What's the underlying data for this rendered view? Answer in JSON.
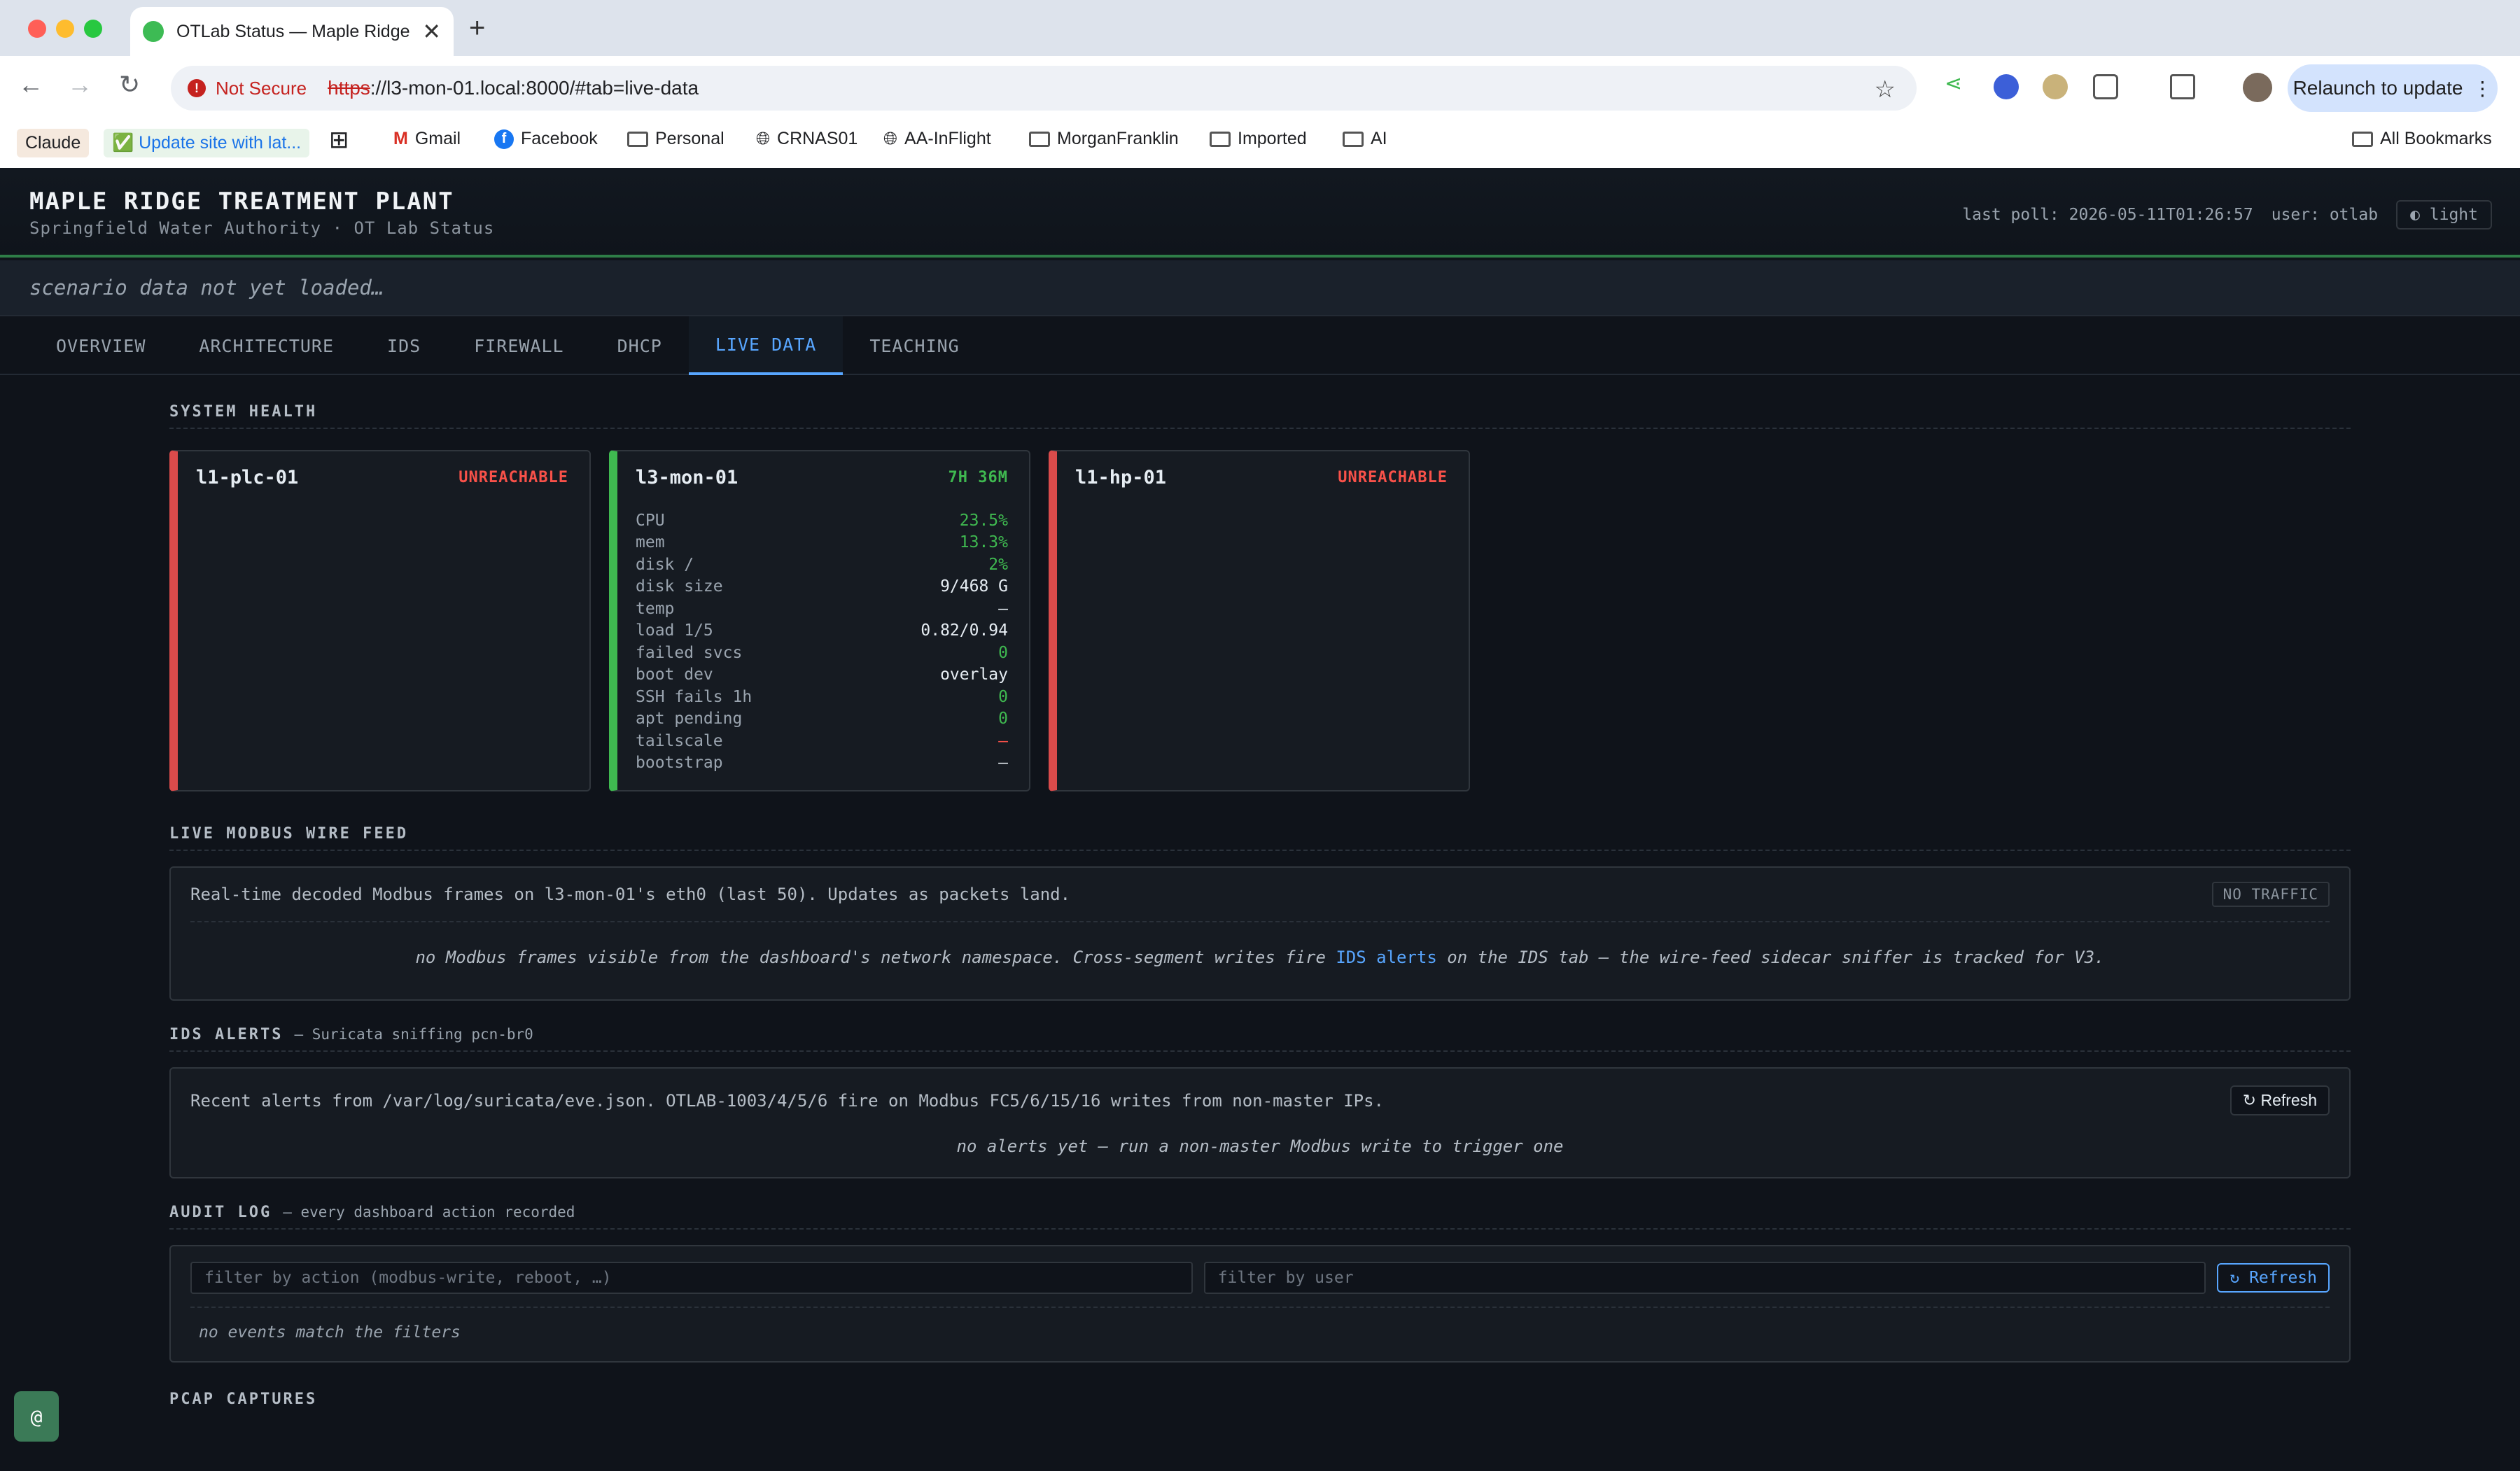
{
  "browser": {
    "tab_title": "OTLab Status — Maple Ridge",
    "security_label": "Not Secure",
    "url_scheme": "https",
    "url_rest": "://l3-mon-01.local:8000/#tab=live-data",
    "relaunch_label": "Relaunch to update",
    "bookmarks": [
      "Claude",
      "✅ Update site with lat...",
      "Gmail",
      "Facebook",
      "Personal",
      "CRNAS01",
      "AA-InFlight",
      "MorganFranklin",
      "Imported",
      "AI"
    ],
    "all_bookmarks": "All Bookmarks"
  },
  "header": {
    "plant": "MAPLE RIDGE TREATMENT PLANT",
    "subtitle": "Springfield Water Authority · OT Lab Status",
    "last_poll": "last poll: 2026-05-11T01:26:57",
    "user": "user: otlab",
    "theme_toggle": "◐ light"
  },
  "scenario": "scenario data not yet loaded…",
  "tabs": [
    "OVERVIEW",
    "ARCHITECTURE",
    "IDS",
    "FIREWALL",
    "DHCP",
    "LIVE DATA",
    "TEACHING"
  ],
  "active_tab": "LIVE DATA",
  "system_health": {
    "title": "SYSTEM HEALTH",
    "cards": [
      {
        "name": "l1-plc-01",
        "status": "UNREACHABLE"
      },
      {
        "name": "l3-mon-01",
        "status": "7H 36M",
        "metrics": [
          {
            "label": "CPU",
            "value": "23.5%",
            "tone": "good"
          },
          {
            "label": "mem",
            "value": "13.3%",
            "tone": "good"
          },
          {
            "label": "disk /",
            "value": "2%",
            "tone": "good"
          },
          {
            "label": "disk size",
            "value": "9/468 G",
            "tone": "plain"
          },
          {
            "label": "temp",
            "value": "—",
            "tone": "plain"
          },
          {
            "label": "load 1/5",
            "value": "0.82/0.94",
            "tone": "plain"
          },
          {
            "label": "failed svcs",
            "value": "0",
            "tone": "good"
          },
          {
            "label": "boot dev",
            "value": "overlay",
            "tone": "plain"
          },
          {
            "label": "SSH fails 1h",
            "value": "0",
            "tone": "good"
          },
          {
            "label": "apt pending",
            "value": "0",
            "tone": "good"
          },
          {
            "label": "tailscale",
            "value": "—",
            "tone": "bad"
          },
          {
            "label": "bootstrap",
            "value": "—",
            "tone": "plain"
          }
        ]
      },
      {
        "name": "l1-hp-01",
        "status": "UNREACHABLE"
      }
    ]
  },
  "modbus": {
    "title": "LIVE MODBUS WIRE FEED",
    "desc": "Real-time decoded Modbus frames on l3-mon-01's eth0 (last 50). Updates as packets land.",
    "badge": "NO TRAFFIC",
    "empty_pre": "no Modbus frames visible from the dashboard's network namespace. Cross-segment writes fire ",
    "empty_link": "IDS alerts",
    "empty_post": " on the IDS tab — the wire-feed sidecar sniffer is tracked for V3."
  },
  "ids": {
    "title": "IDS ALERTS",
    "note": "— Suricata sniffing pcn-br0",
    "desc": "Recent alerts from /var/log/suricata/eve.json. OTLAB-1003/4/5/6 fire on Modbus FC5/6/15/16 writes from non-master IPs.",
    "refresh": "↻ Refresh",
    "empty": "no alerts yet — run a non-master Modbus write to trigger one"
  },
  "audit": {
    "title": "AUDIT LOG",
    "note": "— every dashboard action recorded",
    "filter_action_placeholder": "filter by action (modbus-write, reboot, …)",
    "filter_user_placeholder": "filter by user",
    "refresh": "↻ Refresh",
    "empty": "no events match the filters"
  },
  "pcap": {
    "title": "PCAP CAPTURES"
  },
  "colors": {
    "accent": "#58a6ff",
    "good": "#3fb950",
    "bad": "#f85149",
    "bg": "#0f131a"
  }
}
